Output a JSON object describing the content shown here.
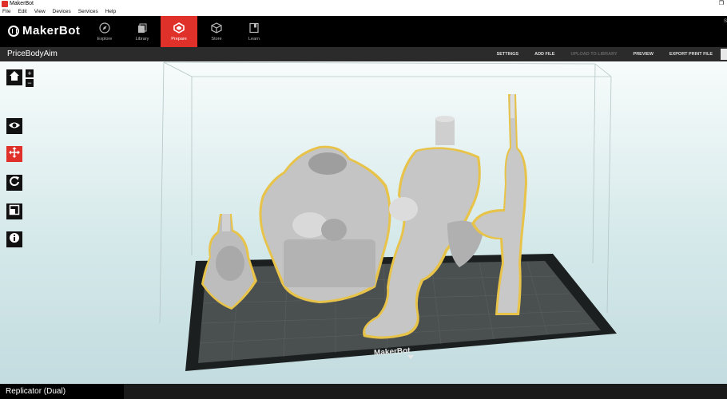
{
  "window": {
    "title": "MakerBot"
  },
  "menu": {
    "items": [
      "File",
      "Edit",
      "View",
      "Devices",
      "Services",
      "Help"
    ]
  },
  "nav": {
    "brand": "MakerBot",
    "tabs": [
      {
        "label": "Explore",
        "icon": "compass-icon",
        "active": false
      },
      {
        "label": "Library",
        "icon": "library-icon",
        "active": false
      },
      {
        "label": "Prepare",
        "icon": "prepare-icon",
        "active": true
      },
      {
        "label": "Store",
        "icon": "cube-icon",
        "active": false
      },
      {
        "label": "Learn",
        "icon": "book-icon",
        "active": false
      }
    ],
    "right_label": "S"
  },
  "subbar": {
    "project_name": "PriceBodyAim",
    "actions": [
      {
        "label": "SETTINGS",
        "enabled": true
      },
      {
        "label": "ADD FILE",
        "enabled": true
      },
      {
        "label": "UPLOAD TO LIBRARY",
        "enabled": false
      },
      {
        "label": "PREVIEW",
        "enabled": true
      },
      {
        "label": "EXPORT PRINT FILE",
        "enabled": true
      }
    ]
  },
  "viewport": {
    "plate_label": "MakerBot",
    "zoom_in": "+",
    "zoom_out": "−",
    "tools": [
      "home-icon",
      "eye-icon",
      "move-icon",
      "rotate-icon",
      "scale-icon",
      "info-icon"
    ],
    "active_tool": "move-icon"
  },
  "colors": {
    "accent": "#e0302a",
    "selection": "#e8c34a",
    "model": "#c9c9c9"
  },
  "status": {
    "printer": "Replicator (Dual)"
  }
}
